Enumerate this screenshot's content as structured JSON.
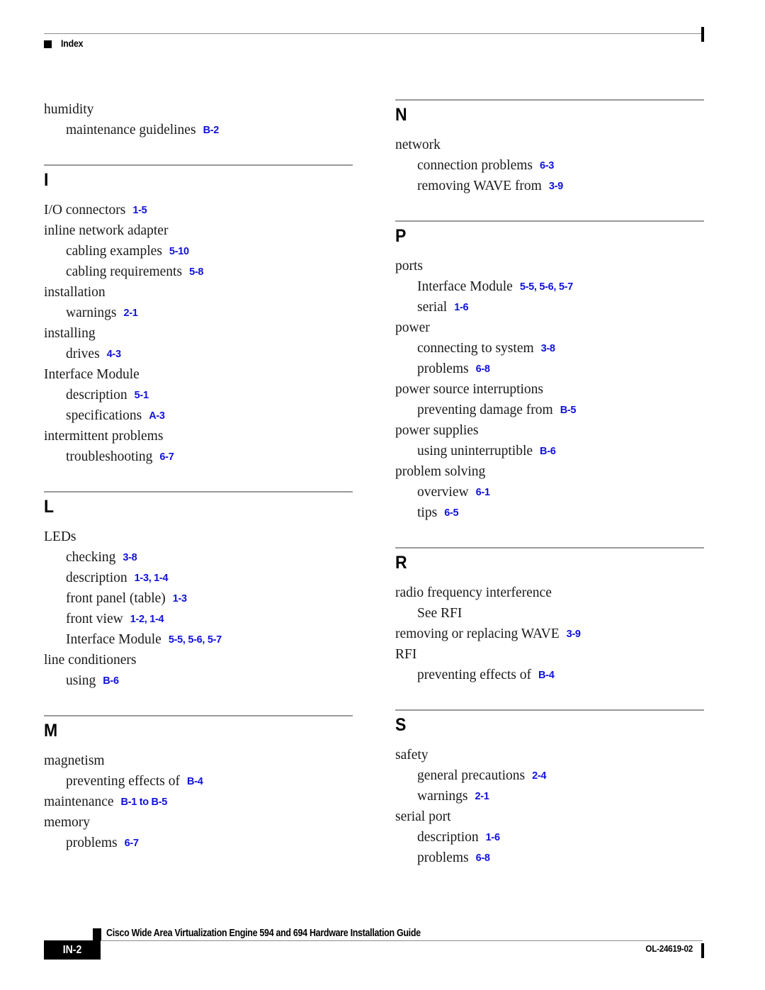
{
  "header": {
    "bullet_icon": "black-square-bullet",
    "title": "Index"
  },
  "colors": {
    "page_reference_blue": "#1111dd",
    "rule_gray": "#8c8c8c",
    "text_black": "#000000"
  },
  "columns": {
    "left": [
      {
        "letter": "",
        "has_rule": false,
        "entries": [
          {
            "level": 0,
            "term": "humidity",
            "pages": ""
          },
          {
            "level": 1,
            "term": "maintenance guidelines",
            "pages": "B-2"
          }
        ]
      },
      {
        "letter": "I",
        "has_rule": true,
        "entries": [
          {
            "level": 0,
            "term": "I/O connectors",
            "pages": "1-5"
          },
          {
            "level": 0,
            "term": "inline network adapter",
            "pages": ""
          },
          {
            "level": 1,
            "term": "cabling examples",
            "pages": "5-10"
          },
          {
            "level": 1,
            "term": "cabling requirements",
            "pages": "5-8"
          },
          {
            "level": 0,
            "term": "installation",
            "pages": ""
          },
          {
            "level": 1,
            "term": "warnings",
            "pages": "2-1"
          },
          {
            "level": 0,
            "term": "installing",
            "pages": ""
          },
          {
            "level": 1,
            "term": "drives",
            "pages": "4-3"
          },
          {
            "level": 0,
            "term": "Interface Module",
            "pages": ""
          },
          {
            "level": 1,
            "term": "description",
            "pages": "5-1"
          },
          {
            "level": 1,
            "term": "specifications",
            "pages": "A-3"
          },
          {
            "level": 0,
            "term": "intermittent problems",
            "pages": ""
          },
          {
            "level": 1,
            "term": "troubleshooting",
            "pages": "6-7"
          }
        ]
      },
      {
        "letter": "L",
        "has_rule": true,
        "entries": [
          {
            "level": 0,
            "term": "LEDs",
            "pages": ""
          },
          {
            "level": 1,
            "term": "checking",
            "pages": "3-8"
          },
          {
            "level": 1,
            "term": "description",
            "pages": "1-3, 1-4"
          },
          {
            "level": 1,
            "term": "front panel (table)",
            "pages": "1-3"
          },
          {
            "level": 1,
            "term": "front view",
            "pages": "1-2, 1-4"
          },
          {
            "level": 1,
            "term": "Interface Module",
            "pages": "5-5, 5-6, 5-7"
          },
          {
            "level": 0,
            "term": "line conditioners",
            "pages": ""
          },
          {
            "level": 1,
            "term": "using",
            "pages": "B-6"
          }
        ]
      },
      {
        "letter": "M",
        "has_rule": true,
        "entries": [
          {
            "level": 0,
            "term": "magnetism",
            "pages": ""
          },
          {
            "level": 1,
            "term": "preventing effects of",
            "pages": "B-4"
          },
          {
            "level": 0,
            "term": "maintenance",
            "pages": "B-1 to B-5"
          },
          {
            "level": 0,
            "term": "memory",
            "pages": ""
          },
          {
            "level": 1,
            "term": "problems",
            "pages": "6-7"
          }
        ]
      }
    ],
    "right": [
      {
        "letter": "N",
        "has_rule": true,
        "entries": [
          {
            "level": 0,
            "term": "network",
            "pages": ""
          },
          {
            "level": 1,
            "term": "connection problems",
            "pages": "6-3"
          },
          {
            "level": 1,
            "term": "removing WAVE from",
            "pages": "3-9"
          }
        ]
      },
      {
        "letter": "P",
        "has_rule": true,
        "entries": [
          {
            "level": 0,
            "term": "ports",
            "pages": ""
          },
          {
            "level": 1,
            "term": "Interface Module",
            "pages": "5-5, 5-6, 5-7"
          },
          {
            "level": 1,
            "term": "serial",
            "pages": "1-6"
          },
          {
            "level": 0,
            "term": "power",
            "pages": ""
          },
          {
            "level": 1,
            "term": "connecting to system",
            "pages": "3-8"
          },
          {
            "level": 1,
            "term": "problems",
            "pages": "6-8"
          },
          {
            "level": 0,
            "term": "power source interruptions",
            "pages": ""
          },
          {
            "level": 1,
            "term": "preventing damage from",
            "pages": "B-5"
          },
          {
            "level": 0,
            "term": "power supplies",
            "pages": ""
          },
          {
            "level": 1,
            "term": "using uninterruptible",
            "pages": "B-6"
          },
          {
            "level": 0,
            "term": "problem solving",
            "pages": ""
          },
          {
            "level": 1,
            "term": "overview",
            "pages": "6-1"
          },
          {
            "level": 1,
            "term": "tips",
            "pages": "6-5"
          }
        ]
      },
      {
        "letter": "R",
        "has_rule": true,
        "entries": [
          {
            "level": 0,
            "term": "radio frequency interference",
            "pages": ""
          },
          {
            "level": 1,
            "term": "See RFI",
            "pages": ""
          },
          {
            "level": 0,
            "term": "removing or replacing WAVE",
            "pages": "3-9"
          },
          {
            "level": 0,
            "term": "RFI",
            "pages": ""
          },
          {
            "level": 1,
            "term": "preventing effects of",
            "pages": "B-4"
          }
        ]
      },
      {
        "letter": "S",
        "has_rule": true,
        "entries": [
          {
            "level": 0,
            "term": "safety",
            "pages": ""
          },
          {
            "level": 1,
            "term": "general precautions",
            "pages": "2-4"
          },
          {
            "level": 1,
            "term": "warnings",
            "pages": "2-1"
          },
          {
            "level": 0,
            "term": "serial port",
            "pages": ""
          },
          {
            "level": 1,
            "term": "description",
            "pages": "1-6"
          },
          {
            "level": 1,
            "term": "problems",
            "pages": "6-8"
          }
        ]
      }
    ]
  },
  "footer": {
    "page_number": "IN-2",
    "document_title": "Cisco Wide Area Virtualization Engine 594 and 694 Hardware Installation Guide",
    "document_id": "OL-24619-02"
  }
}
